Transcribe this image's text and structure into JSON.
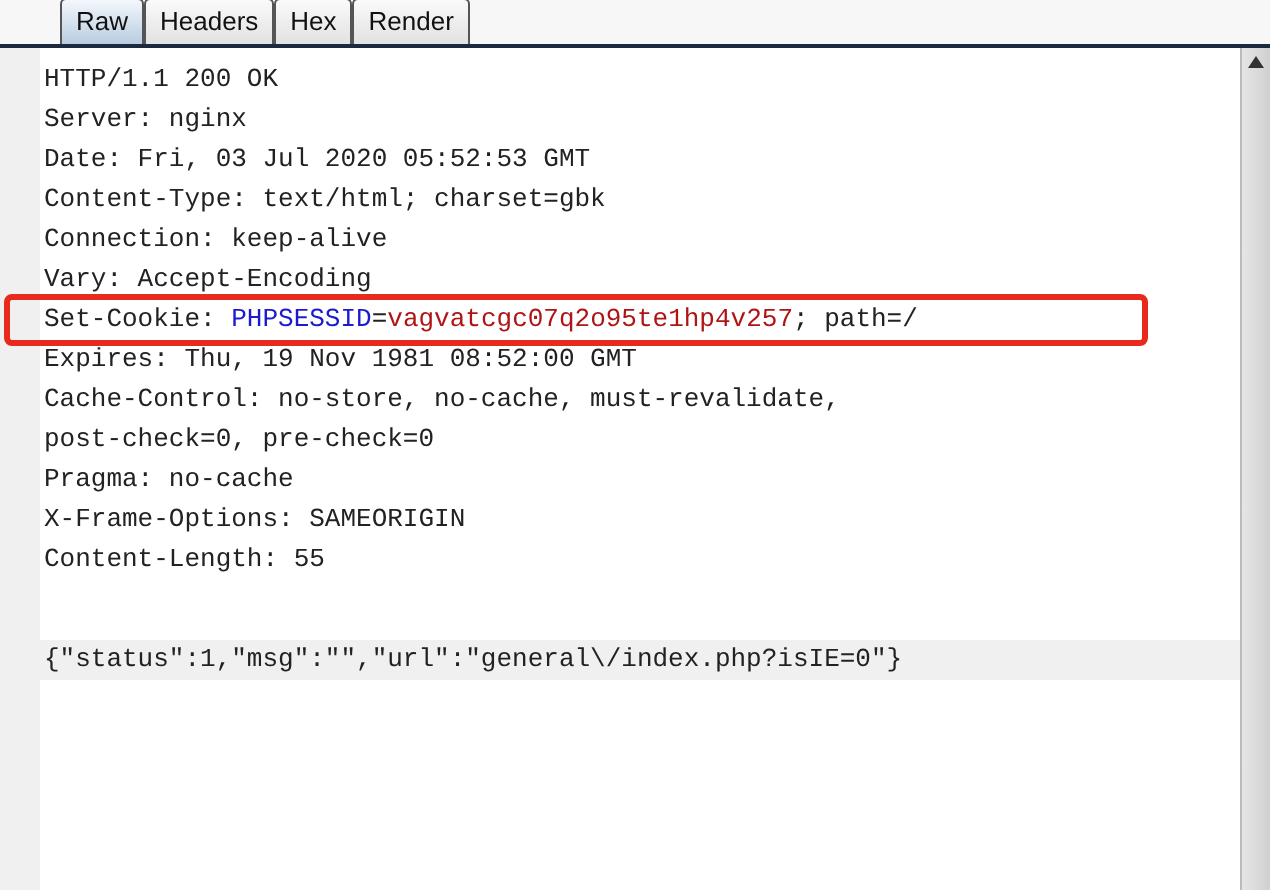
{
  "tabs": [
    {
      "label": "Raw",
      "selected": true
    },
    {
      "label": "Headers",
      "selected": false
    },
    {
      "label": "Hex",
      "selected": false
    },
    {
      "label": "Render",
      "selected": false
    }
  ],
  "lines": [
    {
      "kind": "header",
      "highlighted": false,
      "segments": [
        {
          "kind": "plain",
          "text": "HTTP/1.1 200 OK"
        }
      ]
    },
    {
      "kind": "header",
      "highlighted": false,
      "segments": [
        {
          "kind": "plain",
          "text": "Server: nginx"
        }
      ]
    },
    {
      "kind": "header",
      "highlighted": false,
      "segments": [
        {
          "kind": "plain",
          "text": "Date: Fri, 03 Jul 2020 05:52:53 GMT"
        }
      ]
    },
    {
      "kind": "header",
      "highlighted": false,
      "segments": [
        {
          "kind": "plain",
          "text": "Content-Type: text/html; charset=gbk"
        }
      ]
    },
    {
      "kind": "header",
      "highlighted": false,
      "segments": [
        {
          "kind": "plain",
          "text": "Connection: keep-alive"
        }
      ]
    },
    {
      "kind": "header",
      "highlighted": false,
      "segments": [
        {
          "kind": "plain",
          "text": "Vary: Accept-Encoding"
        }
      ]
    },
    {
      "kind": "header",
      "highlighted": true,
      "segments": [
        {
          "kind": "plain",
          "text": "Set-Cookie: "
        },
        {
          "kind": "name",
          "text": "PHPSESSID"
        },
        {
          "kind": "plain",
          "text": "="
        },
        {
          "kind": "value",
          "text": "vagvatcgc07q2o95te1hp4v257"
        },
        {
          "kind": "plain",
          "text": "; path=/"
        }
      ]
    },
    {
      "kind": "header",
      "highlighted": false,
      "segments": [
        {
          "kind": "plain",
          "text": "Expires: Thu, 19 Nov 1981 08:52:00 GMT"
        }
      ]
    },
    {
      "kind": "header",
      "highlighted": false,
      "segments": [
        {
          "kind": "plain",
          "text": "Cache-Control: no-store, no-cache, must-revalidate,"
        }
      ]
    },
    {
      "kind": "header",
      "highlighted": false,
      "segments": [
        {
          "kind": "plain",
          "text": "post-check=0, pre-check=0"
        }
      ]
    },
    {
      "kind": "header",
      "highlighted": false,
      "segments": [
        {
          "kind": "plain",
          "text": "Pragma: no-cache"
        }
      ]
    },
    {
      "kind": "header",
      "highlighted": false,
      "segments": [
        {
          "kind": "plain",
          "text": "X-Frame-Options: SAMEORIGIN"
        }
      ]
    },
    {
      "kind": "header",
      "highlighted": false,
      "segments": [
        {
          "kind": "plain",
          "text": "Content-Length: 55"
        }
      ]
    },
    {
      "kind": "blank"
    },
    {
      "kind": "body",
      "highlighted": false,
      "segments": [
        {
          "kind": "plain",
          "text": "{\"status\":1,\"msg\":\"\",\"url\":\"general\\/index.php?isIE=0\"}"
        }
      ]
    }
  ]
}
